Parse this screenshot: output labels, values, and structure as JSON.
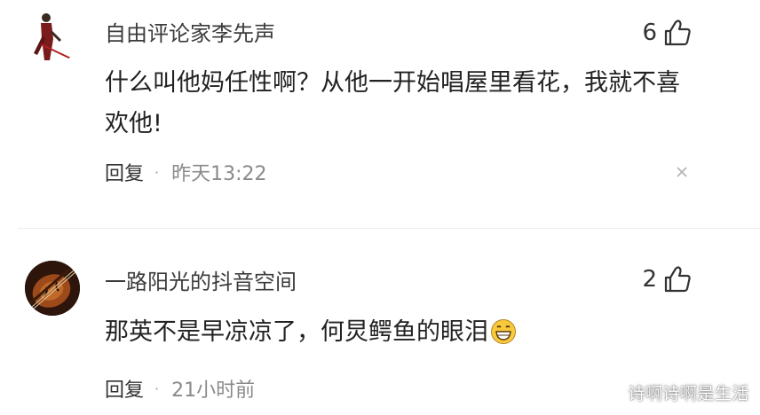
{
  "comments": [
    {
      "username": "自由评论家李先声",
      "likes": "6",
      "text": "什么叫他妈任性啊？从他一开始唱屋里看花，我就不喜欢他!",
      "reply_label": "回复",
      "separator": "·",
      "time": "昨天13:22",
      "avatar_icon": "figure-with-sword-avatar"
    },
    {
      "username": "一路阳光的抖音空间",
      "likes": "2",
      "text": "那英不是早凉凉了，何炅鳄鱼的眼泪",
      "reply_label": "回复",
      "separator": "·",
      "time": "21小时前",
      "avatar_icon": "violin-avatar",
      "emoji": "grinning-face-emoji"
    }
  ],
  "watermark": "诗啊诗啊是生活",
  "colors": {
    "text": "#222222",
    "username": "#3b3b3b",
    "meta": "#8a8a8a",
    "emoji_yellow": "#f8c93a"
  }
}
